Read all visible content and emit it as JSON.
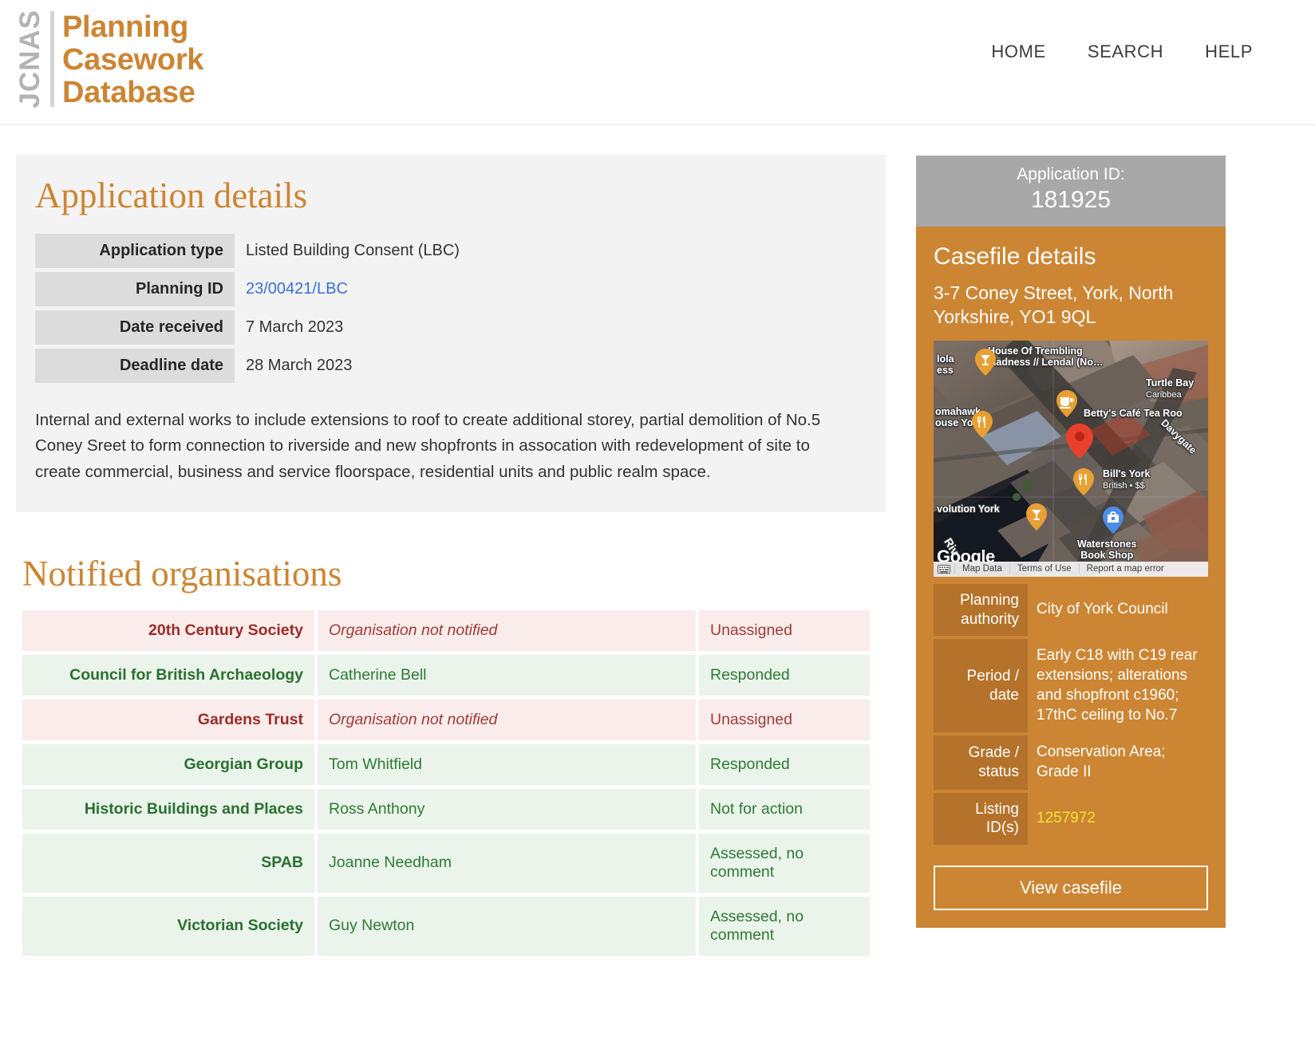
{
  "header": {
    "brand_acronym": "JCNAS",
    "brand_line1": "Planning",
    "brand_line2": "Casework",
    "brand_line3": "Database",
    "nav": [
      {
        "label": "HOME"
      },
      {
        "label": "SEARCH"
      },
      {
        "label": "HELP"
      }
    ]
  },
  "application": {
    "title": "Application details",
    "fields": [
      {
        "label": "Application type",
        "value": "Listed Building Consent (LBC)",
        "link": false
      },
      {
        "label": "Planning ID",
        "value": "23/00421/LBC",
        "link": true
      },
      {
        "label": "Date received",
        "value": "7 March 2023",
        "link": false
      },
      {
        "label": "Deadline date",
        "value": "28 March 2023",
        "link": false
      }
    ],
    "description": "Internal and external works to include extensions to roof to create additional storey, partial demolition of No.5 Coney Sreet to form connection to riverside and new shopfronts in assocation with redevelopment of site to create commercial, business and service floorspace, residential units and public realm space."
  },
  "notified": {
    "title": "Notified organisations",
    "rows": [
      {
        "organisation": "20th Century Society",
        "contact": "Organisation not notified",
        "status": "Unassigned",
        "state": "not-notified"
      },
      {
        "organisation": "Council for British Archaeology",
        "contact": "Catherine Bell",
        "status": "Responded",
        "state": "notified"
      },
      {
        "organisation": "Gardens Trust",
        "contact": "Organisation not notified",
        "status": "Unassigned",
        "state": "not-notified"
      },
      {
        "organisation": "Georgian Group",
        "contact": "Tom Whitfield",
        "status": "Responded",
        "state": "notified"
      },
      {
        "organisation": "Historic Buildings and Places",
        "contact": "Ross Anthony",
        "status": "Not for action",
        "state": "notified"
      },
      {
        "organisation": "SPAB",
        "contact": "Joanne Needham",
        "status": "Assessed, no comment",
        "state": "notified"
      },
      {
        "organisation": "Victorian Society",
        "contact": "Guy Newton",
        "status": "Assessed, no comment",
        "state": "notified"
      }
    ]
  },
  "casefile": {
    "application_id_label": "Application ID:",
    "application_id": "181925",
    "heading": "Casefile details",
    "address": "3-7 Coney Street, York, North Yorkshire, YO1 9QL",
    "fields": [
      {
        "label": "Planning authority",
        "value": "City of York Council",
        "link": false
      },
      {
        "label": "Period / date",
        "value": "Early C18 with C19 rear extensions; alterations and shopfront c1960; 17thC ceiling to No.7",
        "link": false
      },
      {
        "label": "Grade / status",
        "value": "Conservation Area; Grade II",
        "link": false
      },
      {
        "label": "Listing ID(s)",
        "value": "1257972",
        "link": true
      }
    ],
    "view_button": "View casefile"
  },
  "map": {
    "provider_mark": "Google",
    "attribution": [
      {
        "label": "Map Data"
      },
      {
        "label": "Terms of Use"
      },
      {
        "label": "Report a map error"
      }
    ],
    "river_label": "Riv",
    "pois": [
      {
        "name": "lola\ness",
        "kind": "label-only"
      },
      {
        "name": "House Of Trembling\nMadness // Lendal (No…",
        "kind": "bar"
      },
      {
        "name": "Turtle Bay",
        "sub": "Caribbea",
        "kind": "label-only"
      },
      {
        "name": "Betty's Café Tea Roo",
        "kind": "cafe"
      },
      {
        "name": "omahawk\nouse York",
        "kind": "restaurant"
      },
      {
        "name": "Bill's York",
        "sub": "British • $$",
        "kind": "restaurant"
      },
      {
        "name": "volution York",
        "kind": "bar"
      },
      {
        "name": "Waterstones\nBook Shop",
        "kind": "shop"
      },
      {
        "name": "Davygate",
        "kind": "street"
      }
    ]
  },
  "colors": {
    "brand_orange": "#cc8533",
    "brand_grey": "#b3b3b3",
    "link_blue": "#3a6fd8",
    "notified_green": "#2f7a35",
    "not_notified_red": "#a03b37",
    "listing_yellow": "#f2e432",
    "id_bar_grey": "#a8a8a8"
  }
}
